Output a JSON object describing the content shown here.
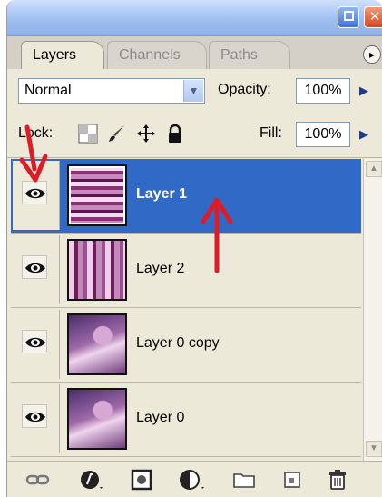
{
  "window": {
    "minimize_label": "",
    "close_label": "✕"
  },
  "tabs": [
    {
      "label": "Layers",
      "active": true
    },
    {
      "label": "Channels",
      "active": false
    },
    {
      "label": "Paths",
      "active": false
    }
  ],
  "menu_button": "▸",
  "blend": {
    "mode": "Normal",
    "opacity_label": "Opacity:",
    "opacity_value": "100%"
  },
  "lock": {
    "label": "Lock:",
    "fill_label": "Fill:",
    "fill_value": "100%"
  },
  "layers": [
    {
      "name": "Layer 1",
      "visible": true,
      "selected": true,
      "thumb": "horizontal-stripes"
    },
    {
      "name": "Layer 2",
      "visible": true,
      "selected": false,
      "thumb": "vertical-stripes"
    },
    {
      "name": "Layer 0 copy",
      "visible": true,
      "selected": false,
      "thumb": "artwork"
    },
    {
      "name": "Layer 0",
      "visible": true,
      "selected": false,
      "thumb": "artwork"
    }
  ],
  "colors": {
    "selection": "#3169c6",
    "panel_bg": "#ece9d8",
    "annotation_arrow": "#e01b24"
  },
  "icons": {
    "link_layers": "link-icon",
    "layer_style": "fx-icon",
    "mask": "mask-icon",
    "adjustment": "adjustment-icon",
    "group": "folder-icon",
    "new_layer": "new-layer-icon",
    "delete": "trash-icon"
  }
}
